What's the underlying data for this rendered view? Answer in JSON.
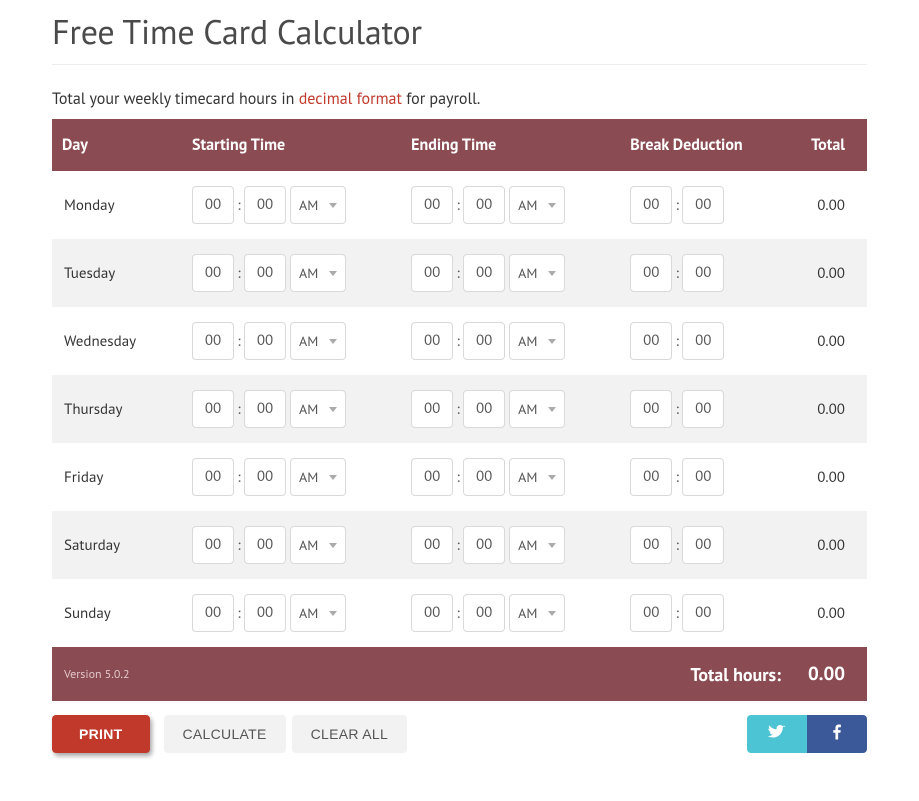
{
  "title": "Free Time Card Calculator",
  "intro_prefix": "Total your weekly timecard hours in ",
  "intro_link": "decimal format",
  "intro_suffix": " for payroll.",
  "headers": {
    "day": "Day",
    "start": "Starting Time",
    "end": "Ending Time",
    "break": "Break Deduction",
    "total": "Total"
  },
  "rows": [
    {
      "day": "Monday",
      "start_h": "00",
      "start_m": "00",
      "start_ap": "AM",
      "end_h": "00",
      "end_m": "00",
      "end_ap": "AM",
      "break_h": "00",
      "break_m": "00",
      "total": "0.00"
    },
    {
      "day": "Tuesday",
      "start_h": "00",
      "start_m": "00",
      "start_ap": "AM",
      "end_h": "00",
      "end_m": "00",
      "end_ap": "AM",
      "break_h": "00",
      "break_m": "00",
      "total": "0.00"
    },
    {
      "day": "Wednesday",
      "start_h": "00",
      "start_m": "00",
      "start_ap": "AM",
      "end_h": "00",
      "end_m": "00",
      "end_ap": "AM",
      "break_h": "00",
      "break_m": "00",
      "total": "0.00"
    },
    {
      "day": "Thursday",
      "start_h": "00",
      "start_m": "00",
      "start_ap": "AM",
      "end_h": "00",
      "end_m": "00",
      "end_ap": "AM",
      "break_h": "00",
      "break_m": "00",
      "total": "0.00"
    },
    {
      "day": "Friday",
      "start_h": "00",
      "start_m": "00",
      "start_ap": "AM",
      "end_h": "00",
      "end_m": "00",
      "end_ap": "AM",
      "break_h": "00",
      "break_m": "00",
      "total": "0.00"
    },
    {
      "day": "Saturday",
      "start_h": "00",
      "start_m": "00",
      "start_ap": "AM",
      "end_h": "00",
      "end_m": "00",
      "end_ap": "AM",
      "break_h": "00",
      "break_m": "00",
      "total": "0.00"
    },
    {
      "day": "Sunday",
      "start_h": "00",
      "start_m": "00",
      "start_ap": "AM",
      "end_h": "00",
      "end_m": "00",
      "end_ap": "AM",
      "break_h": "00",
      "break_m": "00",
      "total": "0.00"
    }
  ],
  "version": "Version 5.0.2",
  "total_hours_label": "Total hours:",
  "grand_total": "0.00",
  "buttons": {
    "print": "PRINT",
    "calculate": "CALCULATE",
    "clear": "CLEAR ALL"
  }
}
